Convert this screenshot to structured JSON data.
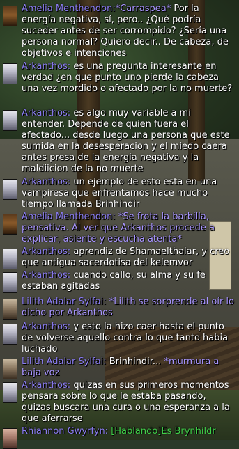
{
  "colors": {
    "speaker_name": "#8b7df0",
    "emote_text": "#a996ff",
    "said_text": "#ffffff",
    "talk_channel": "#41d14a"
  },
  "messages": [
    {
      "speaker": "Amelia Menthendon:",
      "portrait": "amelia-portrait",
      "parts": [
        {
          "kind": "emote",
          "text": "*Carraspea*"
        },
        {
          "kind": "say",
          "text": " Por la energía negativa, sí, pero.. ¿Qué podría suceder antes de ser corrompido? ¿Sería una persona normal? Quiero decir.. De cabeza, de objetivos e intenciones"
        }
      ]
    },
    {
      "speaker": "Arkanthos:",
      "portrait": "arkanthos-portrait",
      "parts": [
        {
          "kind": "say",
          "text": " es una pregunta interesante en verdad ¿en que punto uno pierde la cabeza una vez mordido o afectado por la no muerte?"
        }
      ]
    },
    {
      "speaker": "Arkanthos:",
      "portrait": "arkanthos-portrait",
      "parts": [
        {
          "kind": "say",
          "text": " es algo muy variable a mi entender. Depende de quien fuera el afectado... desde luego una persona que este sumida en la desesperacion y el miedo caera antes presa de la energia negativa y la maldiicion de la no muerte"
        }
      ]
    },
    {
      "speaker": "Arkanthos:",
      "portrait": "arkanthos-portrait",
      "parts": [
        {
          "kind": "say",
          "text": " un ejemplo de esto esta en una vampiresa que enfrentamos hace mucho tiempo llamada Brinhindir"
        }
      ]
    },
    {
      "speaker": "Amelia Menthendon:",
      "portrait": "amelia-portrait",
      "parts": [
        {
          "kind": "emote",
          "text": " *Se frota la barbilla, pensativa. Al ver que Arkanthos procede a explicar, asiente y escucha atenta*"
        }
      ]
    },
    {
      "speaker": "Arkanthos:",
      "portrait": "arkanthos-portrait",
      "parts": [
        {
          "kind": "say",
          "text": " aprendiz de Shamaelthalar, y creo que antigua sacerdotisa del kelemvor"
        }
      ]
    },
    {
      "speaker": "Arkanthos:",
      "portrait": "arkanthos-portrait",
      "parts": [
        {
          "kind": "say",
          "text": " cuando callo, su alma y su fe estaban agitadas"
        }
      ]
    },
    {
      "speaker": "Lilith Adalar Sylfai:",
      "portrait": "lilith-portrait",
      "parts": [
        {
          "kind": "emote",
          "text": " *Lilith se sorprende al oír lo dicho por Arkanthos"
        }
      ]
    },
    {
      "speaker": "Arkanthos:",
      "portrait": "arkanthos-portrait",
      "parts": [
        {
          "kind": "say",
          "text": "  y esto la hizo caer hasta el punto de volverse aquello contra lo que tanto habia luchado"
        }
      ]
    },
    {
      "speaker": "Lilith Adalar Sylfai:",
      "portrait": "lilith-portrait",
      "parts": [
        {
          "kind": "say",
          "text": " Brinhindir... "
        },
        {
          "kind": "emote",
          "text": "*murmura a baja voz"
        }
      ]
    },
    {
      "speaker": "Arkanthos:",
      "portrait": "arkanthos-portrait",
      "parts": [
        {
          "kind": "say",
          "text": " quizas en sus primeros momentos pensara sobre lo que le estaba pasando, quizas buscara una cura o una esperanza a la que aferrarse"
        }
      ]
    },
    {
      "speaker": "Rhiannon Gwyrfyn:",
      "portrait": "rhiannon-portrait",
      "parts": [
        {
          "kind": "talk",
          "text": " [Hablando]Es Brynhildr"
        }
      ]
    }
  ]
}
